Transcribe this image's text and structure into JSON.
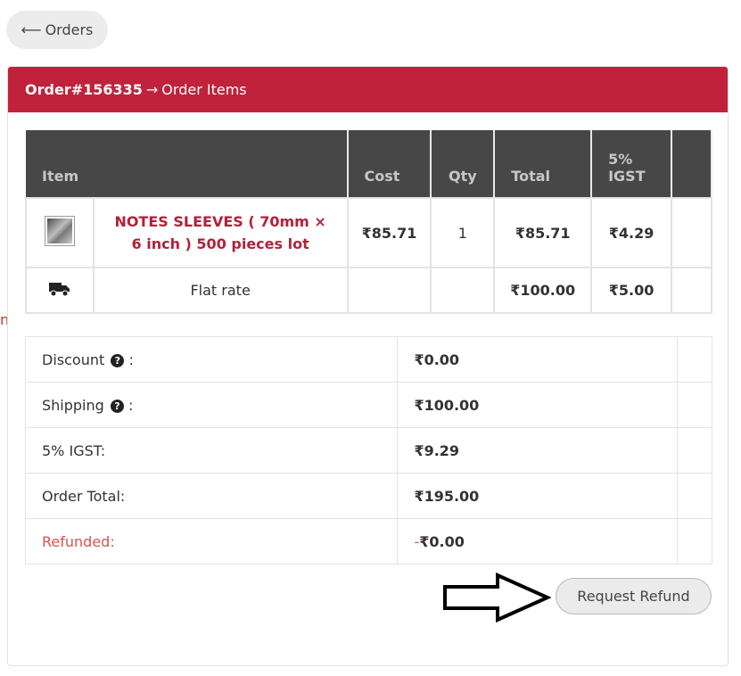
{
  "back": {
    "arrow": "⟵",
    "label": "Orders"
  },
  "edge_text": "n)",
  "header": {
    "order_number": "Order#156335",
    "separator": "→",
    "title": "Order Items"
  },
  "items_table": {
    "columns": [
      "Item",
      "Cost",
      "Qty",
      "Total",
      "5%",
      "IGST"
    ],
    "rows": [
      {
        "name_line1": "NOTES SLEEVES ( 70mm ×",
        "name_line2": "6 inch ) 500 pieces lot",
        "cost": "₹85.71",
        "qty": "1",
        "total": "₹85.71",
        "tax": "₹4.29"
      },
      {
        "name": "Flat rate",
        "cost": "",
        "qty": "",
        "total": "₹100.00",
        "tax": "₹5.00",
        "icon": "truck-icon"
      }
    ]
  },
  "summary": {
    "discount_label": "Discount",
    "discount_suffix": ":",
    "discount_value": "₹0.00",
    "shipping_label": "Shipping",
    "shipping_suffix": ":",
    "shipping_value": "₹100.00",
    "igst_label": "5% IGST:",
    "igst_value": "₹9.29",
    "total_label": "Order Total:",
    "total_value": "₹195.00",
    "refunded_label": "Refunded:",
    "refunded_minus": "-",
    "refunded_value": "₹0.00",
    "help_glyph": "?"
  },
  "refund_button": {
    "label": "Request Refund"
  },
  "colors": {
    "header_bg": "#c0223b",
    "table_head_bg": "#474747",
    "item_name": "#b3203a",
    "refunded": "#d9534f"
  }
}
